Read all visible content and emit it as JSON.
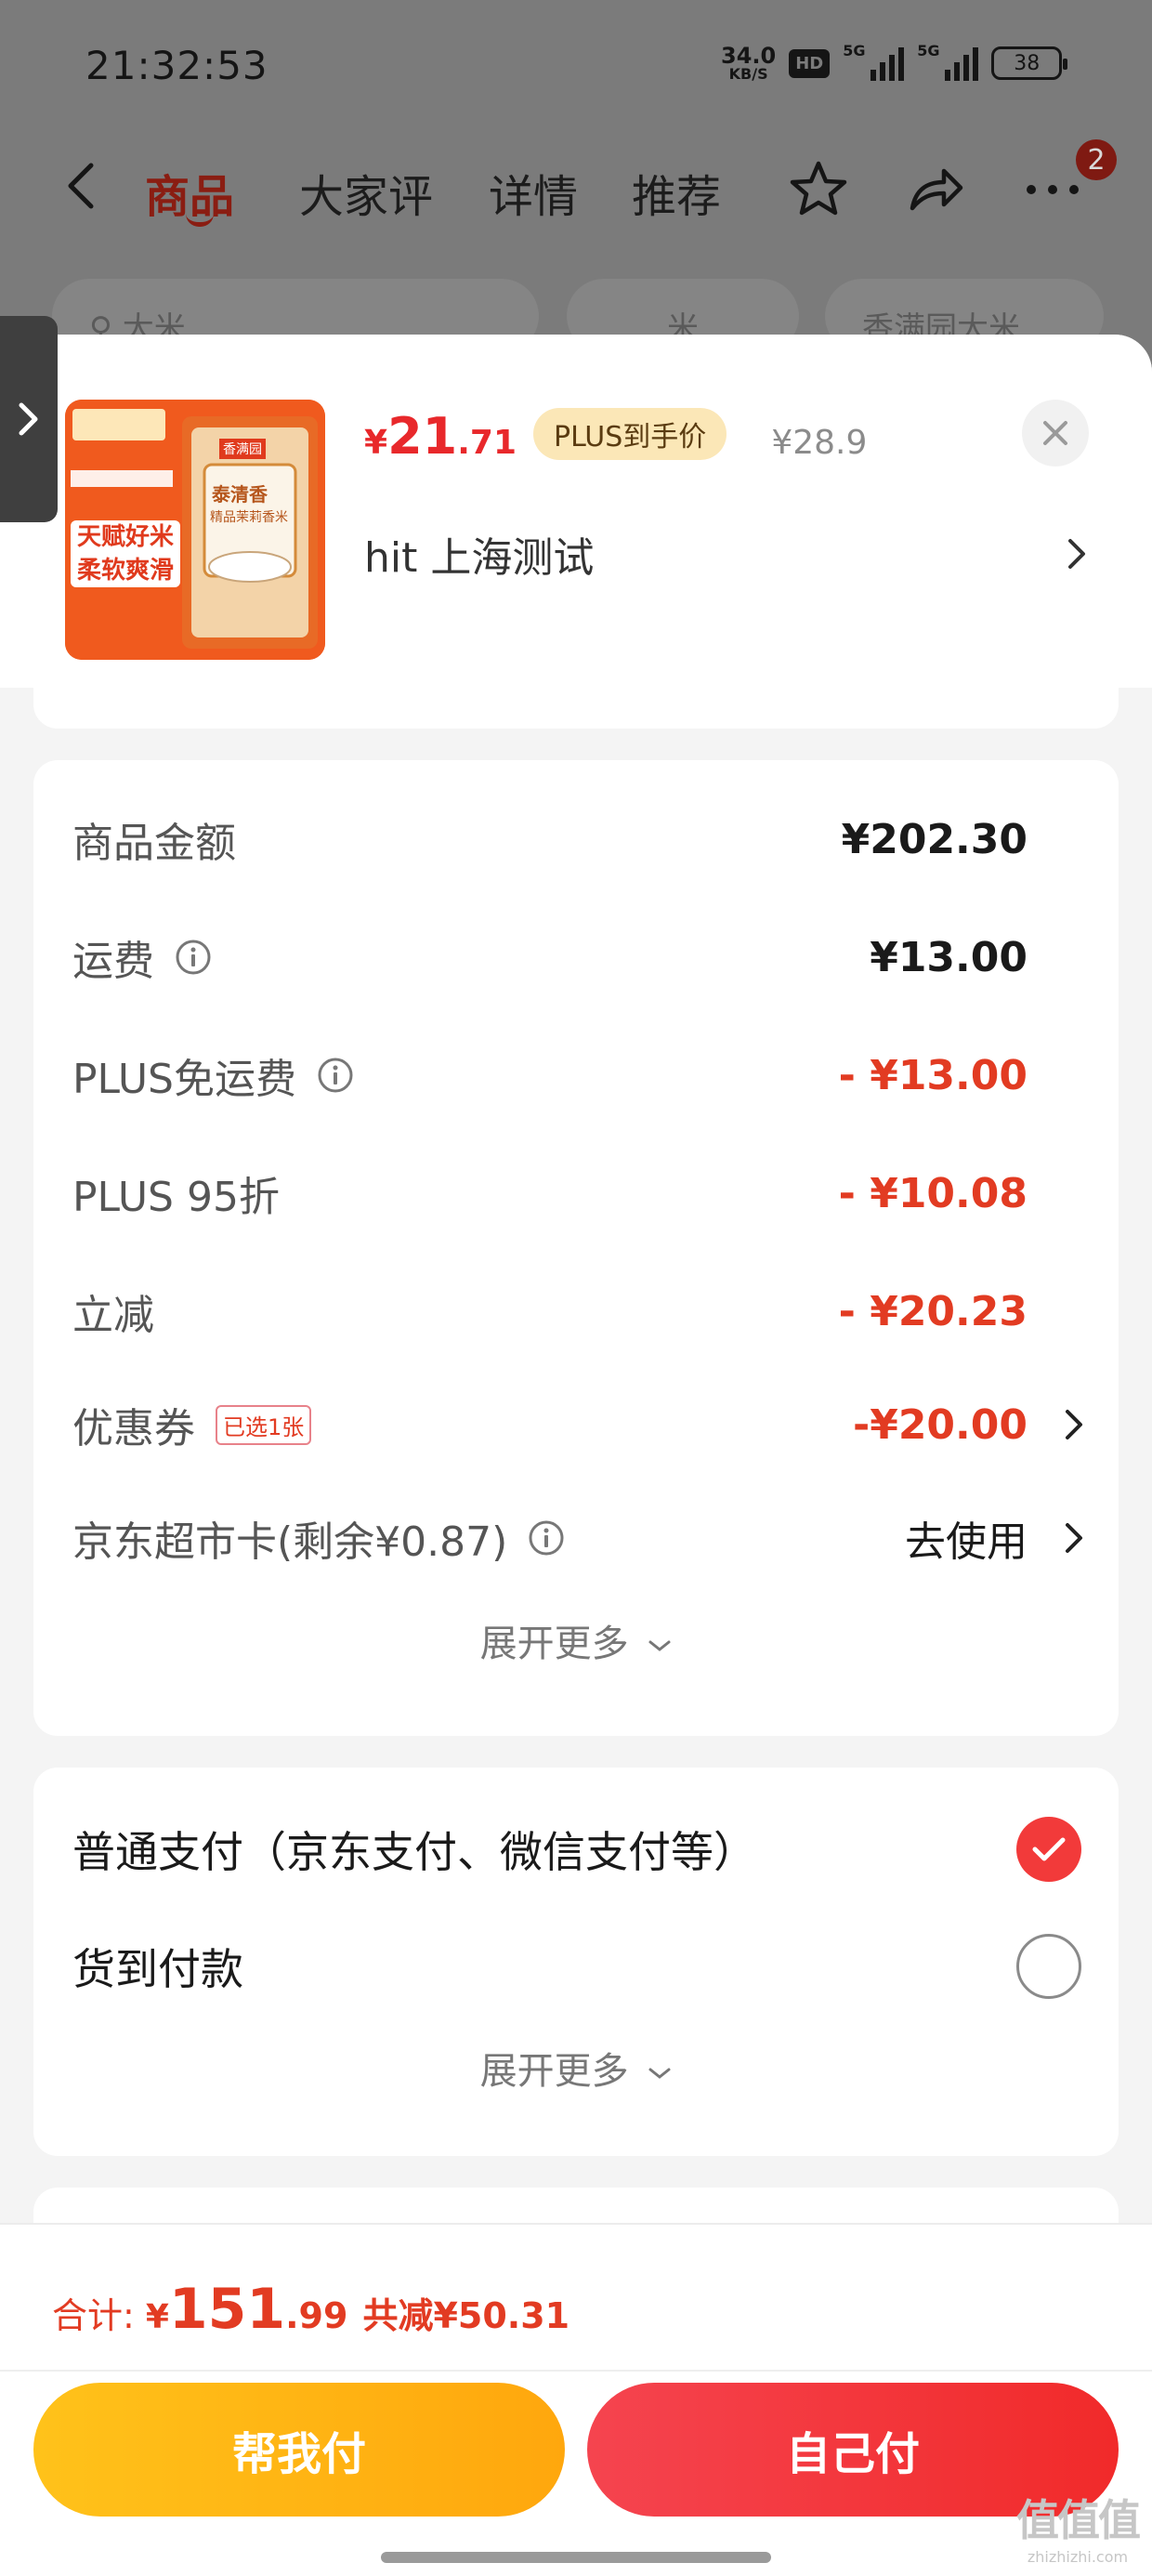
{
  "status_bar": {
    "time": "21:32:53",
    "net_speed_value": "34.0",
    "net_speed_unit": "KB/S",
    "hd_label": "HD",
    "signal1_label": "5G",
    "signal2_label": "5G",
    "battery": "38"
  },
  "nav": {
    "tabs": [
      "商品",
      "大家评",
      "详情",
      "推荐"
    ],
    "active_tab": "商品",
    "notification_count": "2"
  },
  "search_chips": [
    "大米",
    "米",
    "香满园大米"
  ],
  "product": {
    "price_currency": "¥",
    "price_integer": "21",
    "price_decimal": ".71",
    "plus_label": "PLUS到手价",
    "original_price": "¥28.9",
    "address": "hit  上海测试",
    "image_badge": "天赋好米",
    "image_text_1": "柔软爽滑",
    "image_banner": "香满园",
    "image_brand": "泰清香",
    "image_sub": "精品茉莉香米"
  },
  "summary": {
    "items": [
      {
        "label": "商品金额",
        "value": "¥202.30",
        "info": false,
        "style": "normal"
      },
      {
        "label": "运费",
        "value": "¥13.00",
        "info": true,
        "style": "normal"
      },
      {
        "label": "PLUS免运费",
        "value": "- ¥13.00",
        "info": true,
        "style": "red"
      },
      {
        "label": "PLUS 95折",
        "value": "- ¥10.08",
        "info": false,
        "style": "red"
      },
      {
        "label": "立减",
        "value": "- ¥20.23",
        "info": false,
        "style": "red"
      },
      {
        "label": "优惠券",
        "tag": "已选1张",
        "value": "-¥20.00",
        "info": false,
        "style": "red",
        "arrow": true
      },
      {
        "label": "京东超市卡(剩余¥0.87)",
        "value": "去使用",
        "info": true,
        "style": "plain",
        "arrow": true
      }
    ],
    "expand_label": "展开更多"
  },
  "payment": {
    "options": [
      {
        "label": "普通支付（京东支付、微信支付等）",
        "selected": true
      },
      {
        "label": "货到付款",
        "selected": false
      }
    ],
    "expand_label": "展开更多"
  },
  "bottom": {
    "total_label": "合计:",
    "total_currency": "¥",
    "total_integer": "151",
    "total_decimal": ".99",
    "total_saving": "共减¥50.31",
    "help_pay_label": "帮我付",
    "self_pay_label": "自己付"
  },
  "watermark": {
    "logo": "值值值",
    "sub": "zhizhizhi.com"
  },
  "colors": {
    "accent_red": "#e23b22",
    "price_red": "#e8282b",
    "plus_gold": "#fbe7b7",
    "help_btn": "#ffb514",
    "self_btn": "#f33a3d"
  }
}
